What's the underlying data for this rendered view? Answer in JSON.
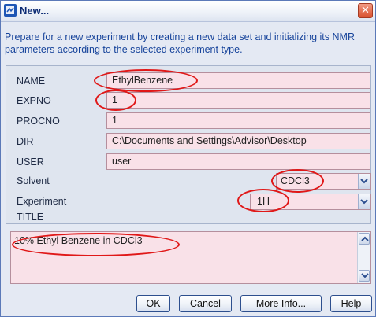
{
  "window": {
    "title": "New...",
    "close_glyph": "✕",
    "icon": "app-icon"
  },
  "intro_text": "Prepare for a new experiment by creating a new data set and initializing its NMR parameters according to the selected experiment type.",
  "fields": {
    "name": {
      "label": "NAME",
      "value": "EthylBenzene"
    },
    "expno": {
      "label": "EXPNO",
      "value": "1"
    },
    "procno": {
      "label": "PROCNO",
      "value": "1"
    },
    "dir": {
      "label": "DIR",
      "value": "C:\\Documents and Settings\\Advisor\\Desktop"
    },
    "user": {
      "label": "USER",
      "value": "user"
    },
    "solvent": {
      "label": "Solvent",
      "value": "CDCl3"
    },
    "experiment": {
      "label": "Experiment",
      "value": "1H"
    },
    "title": {
      "label": "TITLE",
      "value": "10% Ethyl Benzene in CDCl3"
    }
  },
  "buttons": {
    "ok": "OK",
    "cancel": "Cancel",
    "more_info": "More Info...",
    "help": "Help"
  },
  "colors": {
    "field_background": "#f9e1e8",
    "annotation_red": "#e01818",
    "intro_text": "#17449b"
  }
}
